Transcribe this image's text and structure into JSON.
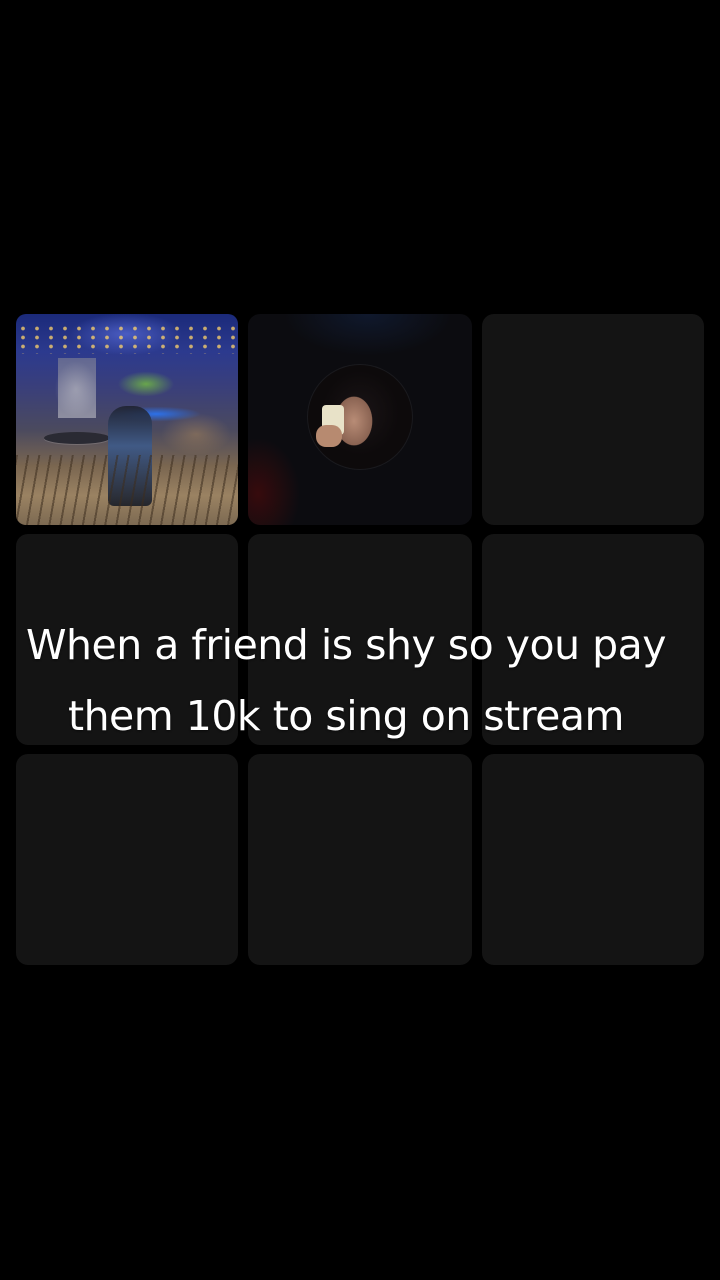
{
  "caption": {
    "text": "When a friend is shy so you pay them 10k to sing on stream"
  },
  "grid": {
    "tiles": [
      {
        "kind": "photo",
        "icon": "bar-scene-photo"
      },
      {
        "kind": "avatar",
        "icon": "user-avatar"
      },
      {
        "kind": "empty"
      },
      {
        "kind": "empty"
      },
      {
        "kind": "empty"
      },
      {
        "kind": "empty"
      },
      {
        "kind": "empty"
      },
      {
        "kind": "empty"
      },
      {
        "kind": "empty"
      }
    ]
  },
  "colors": {
    "background": "#000000",
    "tile": "#141414",
    "caption_text": "#ffffff"
  }
}
